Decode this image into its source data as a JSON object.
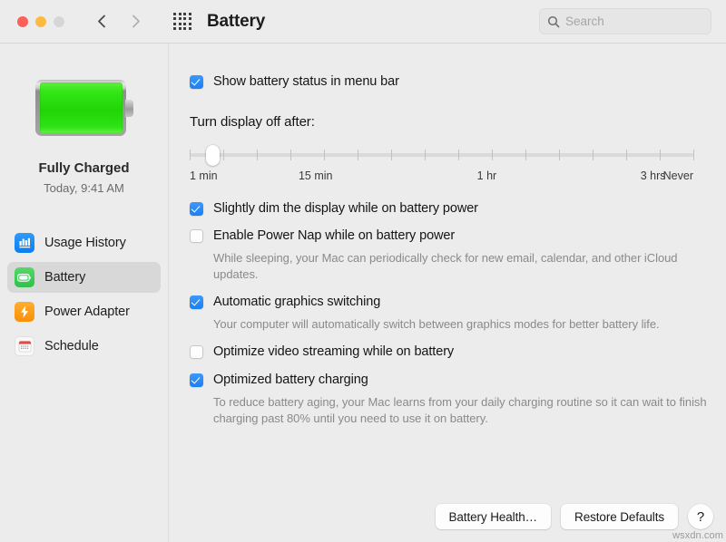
{
  "window": {
    "title": "Battery",
    "traffic_lights": [
      "close",
      "minimize",
      "zoom"
    ]
  },
  "toolbar": {
    "back_icon": "chevron-left-icon",
    "forward_icon": "chevron-right-icon",
    "grid_icon": "show-all-grid-icon",
    "search": {
      "placeholder": "Search",
      "value": "",
      "icon": "search-icon"
    }
  },
  "sidebar": {
    "battery_status": "Fully Charged",
    "battery_time": "Today, 9:41 AM",
    "battery_level_percent": 100,
    "items": [
      {
        "label": "Usage History",
        "icon": "usage-history-icon",
        "selected": false
      },
      {
        "label": "Battery",
        "icon": "battery-icon",
        "selected": true
      },
      {
        "label": "Power Adapter",
        "icon": "power-adapter-icon",
        "selected": false
      },
      {
        "label": "Schedule",
        "icon": "schedule-icon",
        "selected": false
      }
    ]
  },
  "main": {
    "menu_bar_option": {
      "label": "Show battery status in menu bar",
      "checked": true
    },
    "display_sleep": {
      "title": "Turn display off after:",
      "value_label": "1 min",
      "knob_percent": 4,
      "tick_count": 16,
      "labels": [
        {
          "text": "1 min",
          "percent": 0
        },
        {
          "text": "15 min",
          "percent": 25
        },
        {
          "text": "1 hr",
          "percent": 59
        },
        {
          "text": "3 hrs",
          "percent": 92
        },
        {
          "text": "Never",
          "percent": 100
        }
      ]
    },
    "options": [
      {
        "label": "Slightly dim the display while on battery power",
        "checked": true,
        "note": ""
      },
      {
        "label": "Enable Power Nap while on battery power",
        "checked": false,
        "note": "While sleeping, your Mac can periodically check for new email, calendar, and other iCloud updates."
      },
      {
        "label": "Automatic graphics switching",
        "checked": true,
        "note": "Your computer will automatically switch between graphics modes for better battery life."
      },
      {
        "label": "Optimize video streaming while on battery",
        "checked": false,
        "note": ""
      },
      {
        "label": "Optimized battery charging",
        "checked": true,
        "note": "To reduce battery aging, your Mac learns from your daily charging routine so it can wait to finish charging past 80% until you need to use it on battery."
      }
    ],
    "buttons": {
      "battery_health": "Battery Health…",
      "restore_defaults": "Restore Defaults",
      "help": "?"
    }
  },
  "watermark": "wsxdn.com",
  "colors": {
    "accent_blue": "#1a7ff3",
    "battery_green": "#2fc04b",
    "window_bg": "#ececec",
    "selected_row": "#d8d8d8"
  }
}
